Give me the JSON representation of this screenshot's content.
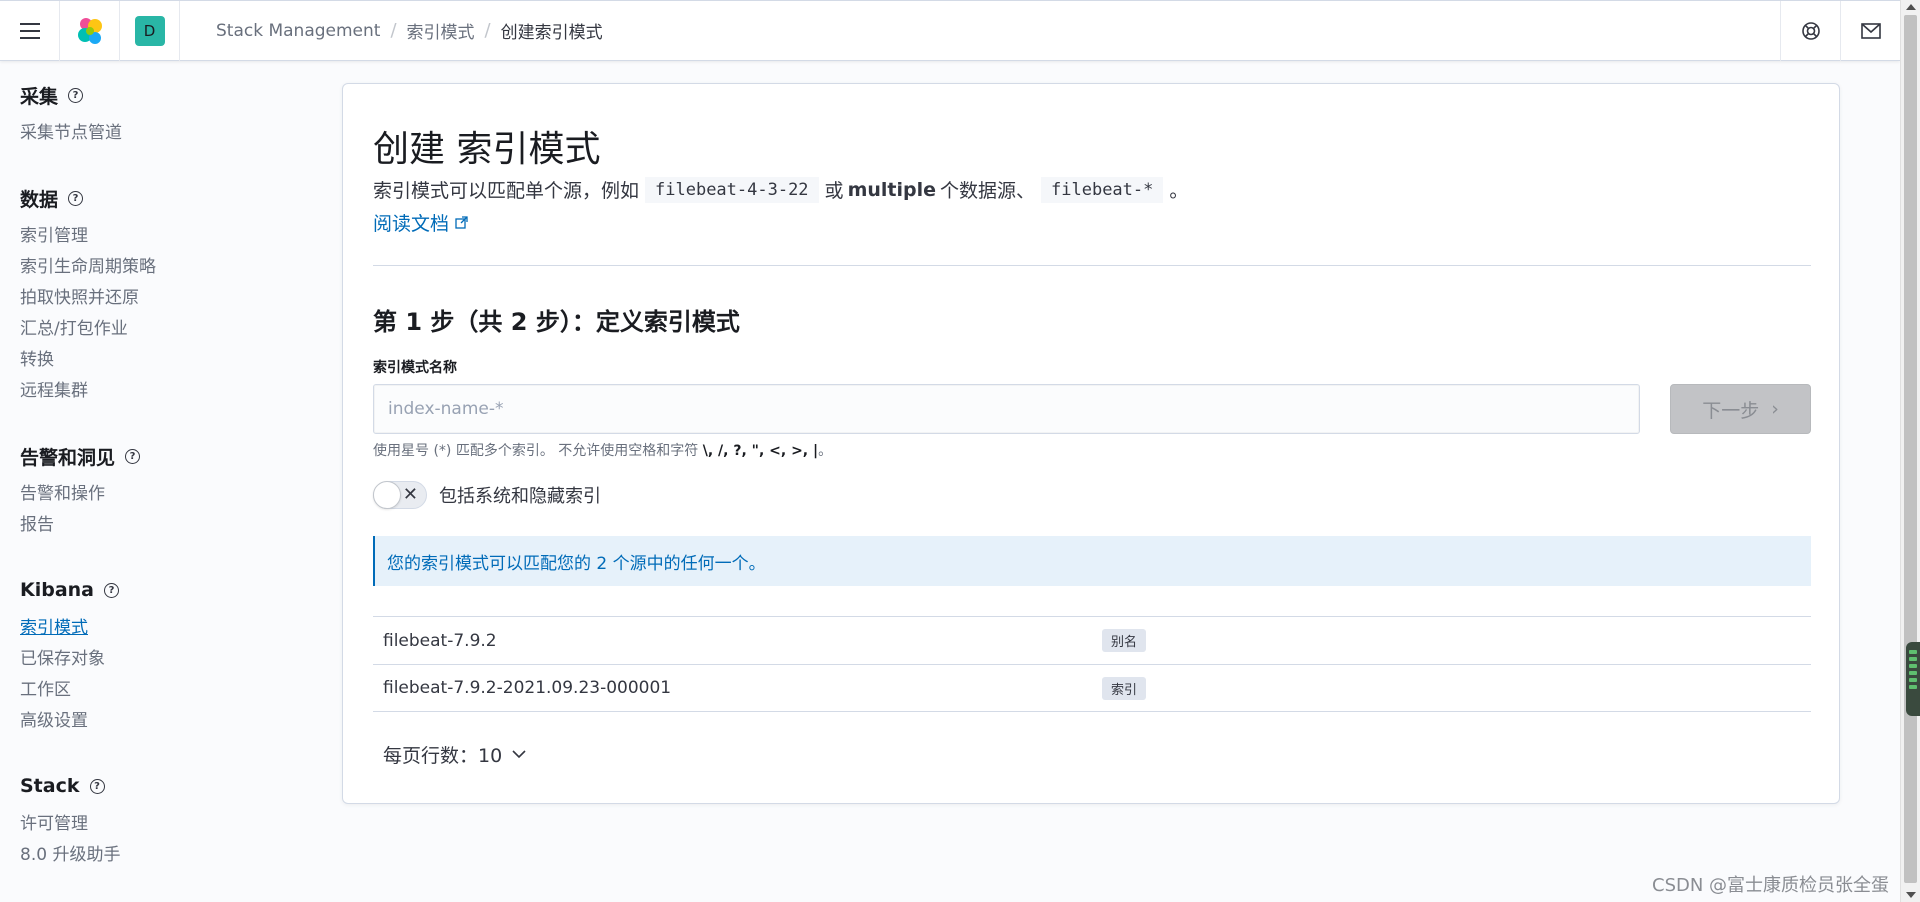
{
  "header": {
    "space_initial": "D",
    "breadcrumbs": [
      "Stack Management",
      "索引模式",
      "创建索引模式"
    ]
  },
  "sidebar": {
    "groups": [
      {
        "title": "采集",
        "items": [
          "采集节点管道"
        ]
      },
      {
        "title": "数据",
        "items": [
          "索引管理",
          "索引生命周期策略",
          "拍取快照并还原",
          "汇总/打包作业",
          "转换",
          "远程集群"
        ]
      },
      {
        "title": "告警和洞见",
        "items": [
          "告警和操作",
          "报告"
        ]
      },
      {
        "title": "Kibana",
        "items": [
          "索引模式",
          "已保存对象",
          "工作区",
          "高级设置"
        ],
        "active_item": "索引模式"
      },
      {
        "title": "Stack",
        "items": [
          "许可管理",
          "8.0 升级助手"
        ]
      }
    ]
  },
  "main": {
    "title": "创建 索引模式",
    "desc_part1": "索引模式可以匹配单个源，例如",
    "desc_code1": "filebeat-4-3-22",
    "desc_part2": "或",
    "desc_bold": "multiple",
    "desc_part3": "个数据源、",
    "desc_code2": "filebeat-*",
    "desc_part4": "。",
    "docs_link": "阅读文档",
    "step_title": "第 1 步（共 2 步）：定义索引模式",
    "field_label": "索引模式名称",
    "input_placeholder": "index-name-*",
    "input_value": "",
    "next_button": "下一步",
    "help_text_prefix": "使用星号 (*) 匹配多个索引。 不允许使用空格和字符",
    "help_text_chars": "\\, /, ?, \", <, >, |",
    "help_text_suffix": "。",
    "toggle_label": "包括系统和隐藏索引",
    "callout": "您的索引模式可以匹配您的 2 个源中的任何一个。",
    "sources": [
      {
        "name": "filebeat-7.9.2",
        "type": "别名"
      },
      {
        "name": "filebeat-7.9.2-2021.09.23-000001",
        "type": "索引"
      }
    ],
    "rows_per_page_label": "每页行数：10"
  },
  "watermark": "CSDN @富士康质检员张全蛋",
  "colors": {
    "accent": "#006bb8",
    "space_avatar": "#29b6a6",
    "callout_bg": "#e6f1fa"
  }
}
